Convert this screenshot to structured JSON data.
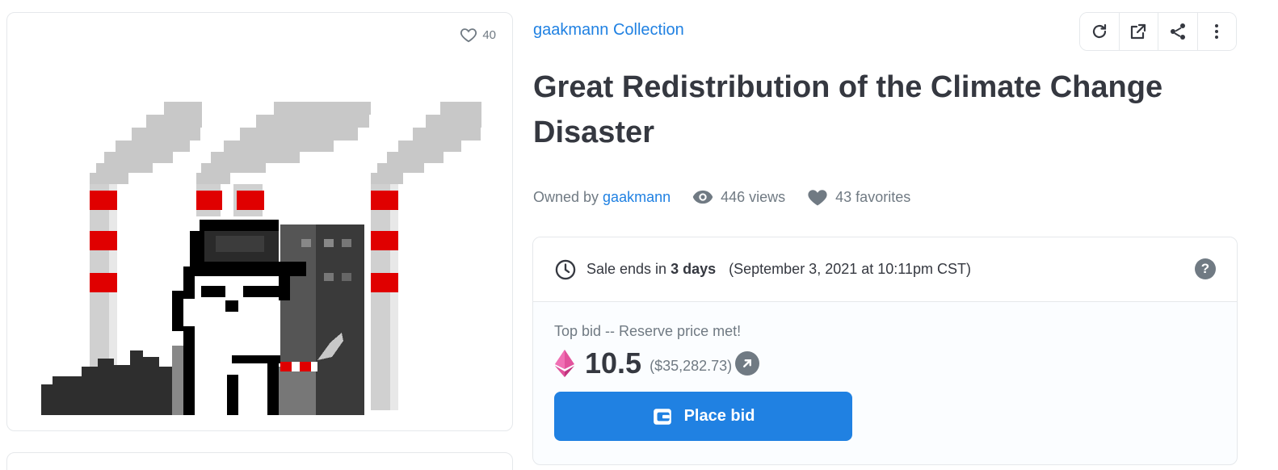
{
  "image_card": {
    "favorites_count": "40"
  },
  "collection": {
    "name": "gaakmann Collection"
  },
  "toolbar": {
    "refresh_icon": "refresh-icon",
    "external_icon": "external-link-icon",
    "share_icon": "share-icon",
    "more_icon": "more-vertical-icon"
  },
  "item": {
    "title": "Great Redistribution of the Climate Change Disaster",
    "owned_by_label": "Owned by",
    "owner": "gaakmann",
    "views": "446 views",
    "favorites": "43 favorites"
  },
  "sale": {
    "ends_prefix": "Sale ends in",
    "ends_in": "3 days",
    "end_date": "(September 3, 2021 at 10:11pm CST)",
    "help_label": "?",
    "top_bid_label": "Top bid -- Reserve price met!",
    "price": "10.5",
    "price_usd": "($35,282.73)",
    "bid_button_label": "Place bid"
  },
  "colors": {
    "accent": "#2081e2",
    "text_dark": "#353840",
    "text_muted": "#707a83",
    "border": "#e5e8eb"
  }
}
